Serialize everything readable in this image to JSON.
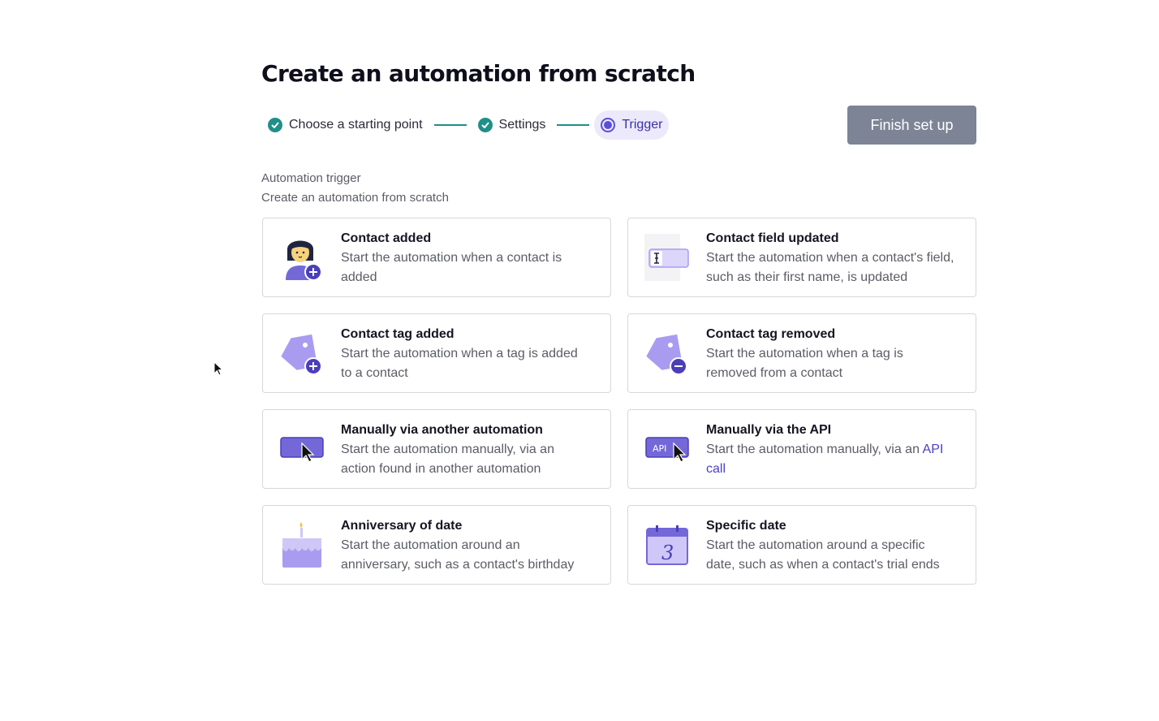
{
  "page": {
    "title": "Create an automation from scratch"
  },
  "stepper": {
    "steps": [
      {
        "label": "Choose a starting point",
        "state": "complete"
      },
      {
        "label": "Settings",
        "state": "complete"
      },
      {
        "label": "Trigger",
        "state": "active"
      }
    ]
  },
  "actions": {
    "finish_label": "Finish set up"
  },
  "section": {
    "label": "Automation trigger",
    "subtitle": "Create an automation from scratch"
  },
  "triggers": [
    {
      "icon": "contact-added-icon",
      "title": "Contact added",
      "desc": "Start the automation when a contact is added"
    },
    {
      "icon": "contact-field-icon",
      "title": "Contact field updated",
      "desc": "Start the automation when a contact's field, such as their first name, is updated"
    },
    {
      "icon": "tag-add-icon",
      "title": "Contact tag added",
      "desc": "Start the automation when a tag is added to a contact"
    },
    {
      "icon": "tag-remove-icon",
      "title": "Contact tag removed",
      "desc": "Start the automation when a tag is removed from a contact"
    },
    {
      "icon": "automation-cursor-icon",
      "title": "Manually via another automation",
      "desc": "Start the automation manually, via an action found in another automation"
    },
    {
      "icon": "api-cursor-icon",
      "title": "Manually via the API",
      "desc_prefix": "Start the automation manually, via an ",
      "desc_link": "API call"
    },
    {
      "icon": "birthday-cake-icon",
      "title": "Anniversary of date",
      "desc": "Start the automation around an anniversary, such as a contact's birthday"
    },
    {
      "icon": "calendar-icon",
      "title": "Specific date",
      "desc": "Start the automation around a specific date, such as when a contact's trial ends",
      "calendar_day": "3"
    }
  ],
  "colors": {
    "accent": "#5b4fd6",
    "complete": "#1f8f8a",
    "button_disabled": "#7c8495",
    "icon_purple": "#a99cf0"
  }
}
